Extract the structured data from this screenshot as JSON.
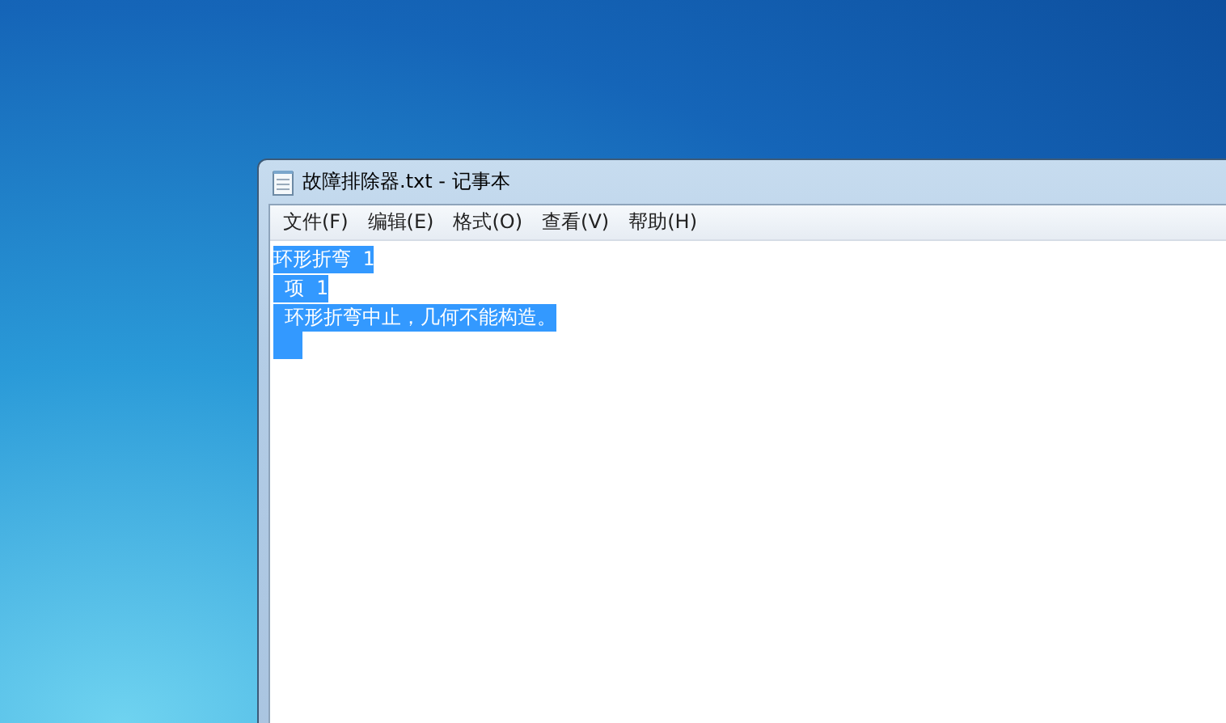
{
  "window": {
    "title": "故障排除器.txt - 记事本"
  },
  "menu": [
    {
      "label": "文件(F)"
    },
    {
      "label": "编辑(E)"
    },
    {
      "label": "格式(O)"
    },
    {
      "label": "查看(V)"
    },
    {
      "label": "帮助(H)"
    }
  ],
  "document": {
    "lines": [
      {
        "text": "环形折弯 1",
        "selected": true
      },
      {
        "text": " 项 1",
        "selected": true
      },
      {
        "text": " 环形折弯中止，几何不能构造。",
        "selected": true
      }
    ],
    "trailing_line_selected": true
  }
}
